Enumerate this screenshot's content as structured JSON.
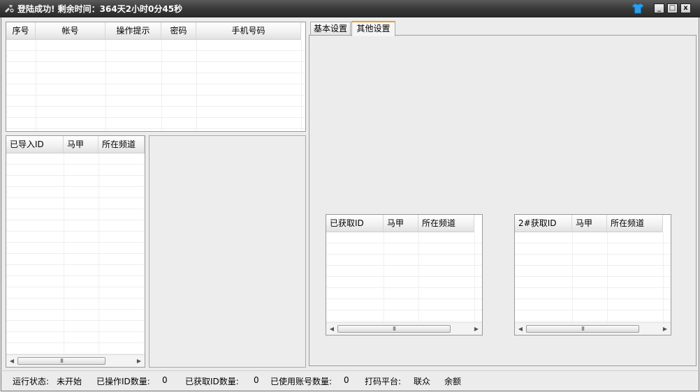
{
  "window": {
    "title": "登陆成功! 剩余时间：364天2小时0分45秒",
    "controls": {
      "minimize": "_",
      "maximize": "□",
      "close": "x"
    }
  },
  "account_table": {
    "columns": [
      "序号",
      "帐号",
      "操作提示",
      "密码",
      "手机号码"
    ],
    "rows": []
  },
  "imported_table": {
    "columns": [
      "已导入ID",
      "马甲",
      "所在频道"
    ],
    "scroll_thumb": "III",
    "rows": []
  },
  "tabs": [
    {
      "label": "基本设置",
      "active": false
    },
    {
      "label": "其他设置",
      "active": true
    }
  ],
  "fetched_table": {
    "columns": [
      "已获取ID",
      "马甲",
      "所在频道"
    ],
    "scroll_thumb": "III",
    "rows": []
  },
  "fetched2_table": {
    "columns": [
      "2#获取ID",
      "马甲",
      "所在频道"
    ],
    "scroll_thumb": "III",
    "rows": []
  },
  "status": {
    "run_label": "运行状态:",
    "run_value": "未开始",
    "ops_label": "已操作ID数量:",
    "ops_value": "0",
    "fetched_label": "已获取ID数量:",
    "fetched_value": "0",
    "used_label": "已使用账号数量:",
    "used_value": "0",
    "captcha_label": "打码平台:",
    "captcha_value": "联众",
    "balance_label": "余额"
  },
  "colors": {
    "titlebar": "#3a3a3a",
    "tab_accent": "#f0a020",
    "skin_icon": "#2a9ee8"
  },
  "icons": {
    "app": "tools-icon",
    "skin": "shirt-icon"
  }
}
